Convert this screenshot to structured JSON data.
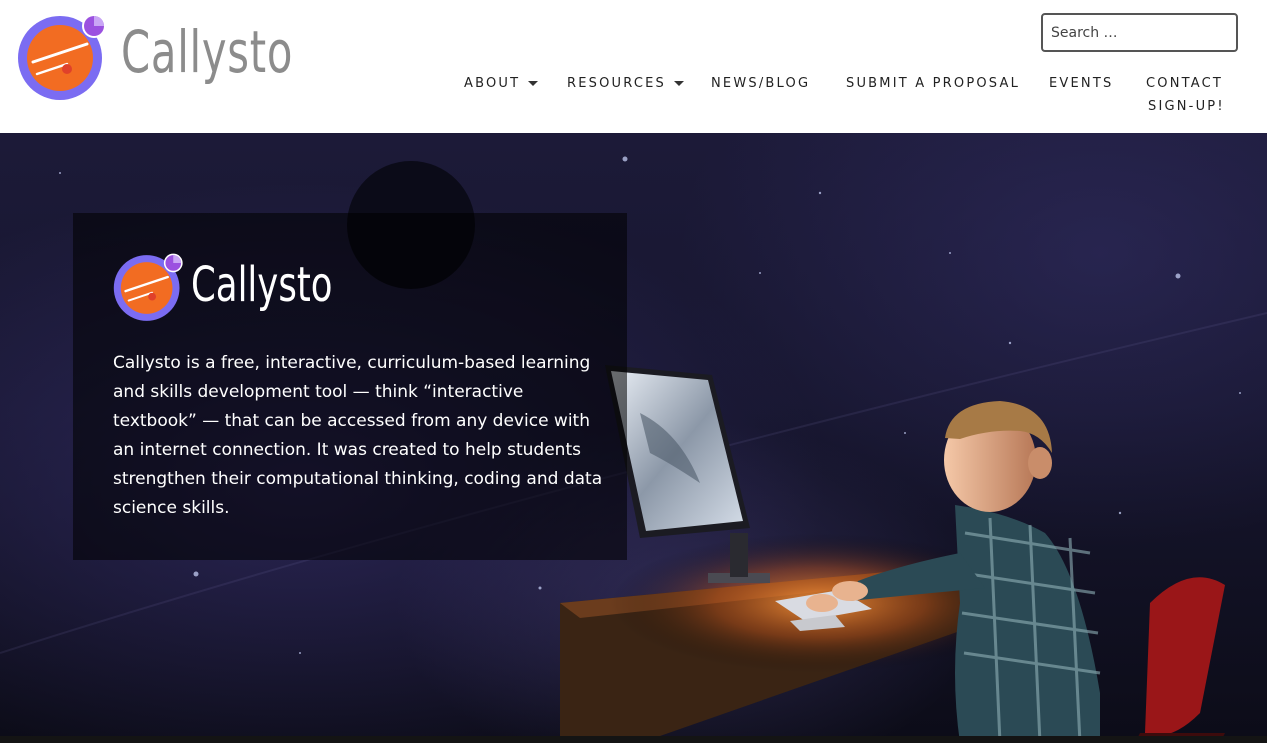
{
  "brand": {
    "name": "Callysto",
    "colors": {
      "orange": "#f26c22",
      "purple": "#7b6cf2",
      "violet": "#9b51e0",
      "wordmark_gray": "#8c8c8c"
    }
  },
  "search": {
    "placeholder": "Search …"
  },
  "nav": {
    "items": [
      {
        "label": "ABOUT",
        "has_dropdown": true
      },
      {
        "label": "RESOURCES",
        "has_dropdown": true
      },
      {
        "label": "NEWS/BLOG",
        "has_dropdown": false
      },
      {
        "label": "SUBMIT A PROPOSAL",
        "has_dropdown": false
      },
      {
        "label": "EVENTS",
        "has_dropdown": false
      },
      {
        "label": "CONTACT",
        "has_dropdown": false
      },
      {
        "label": "SIGN-UP!",
        "has_dropdown": false
      }
    ]
  },
  "hero": {
    "brand_name": "Callysto",
    "intro": "Callysto is a free, interactive, curriculum-based learning and skills development tool — think “interactive textbook” — that can be accessed from any device with an internet connection. It was created to help students strengthen their computational thinking, coding and data science skills."
  }
}
